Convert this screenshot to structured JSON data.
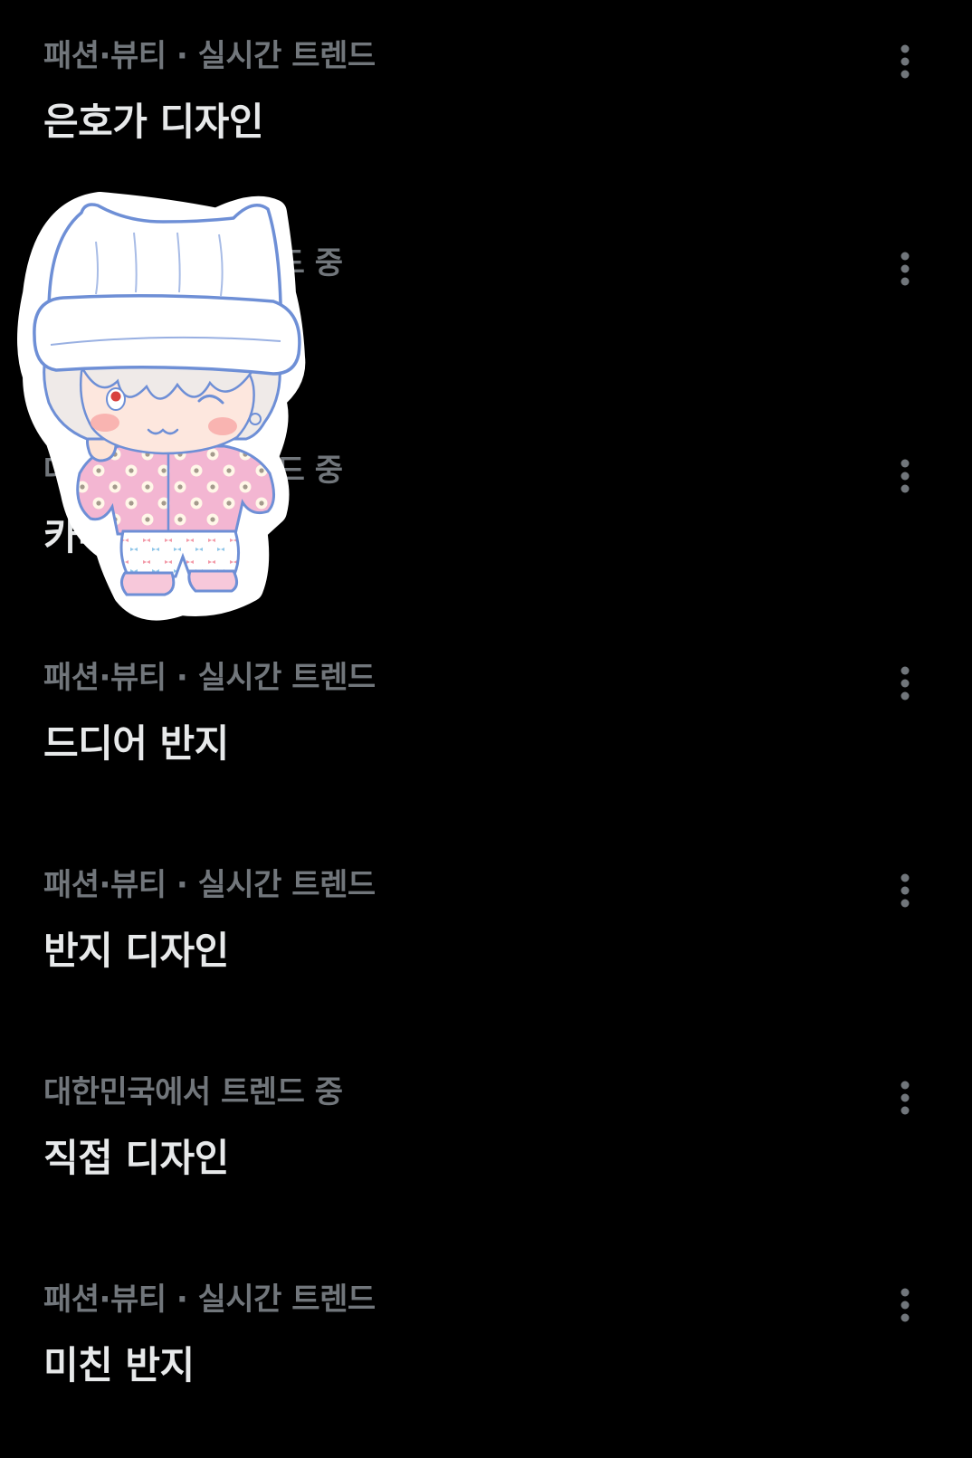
{
  "trends": [
    {
      "context": "패션·뷰티 · 실시간 트렌드",
      "title": "은호가 디자인"
    },
    {
      "context": "대한민국에서 트렌드 중",
      "title": ""
    },
    {
      "context": "대한민국에서 트렌드 중",
      "title": "카메"
    },
    {
      "context": "패션·뷰티 · 실시간 트렌드",
      "title": "드디어 반지"
    },
    {
      "context": "패션·뷰티 · 실시간 트렌드",
      "title": "반지 디자인"
    },
    {
      "context": "대한민국에서 트렌드 중",
      "title": "직접 디자인"
    },
    {
      "context": "패션·뷰티 · 실시간 트렌드",
      "title": "미친 반지"
    }
  ],
  "icons": {
    "more": "more-vertical-icon",
    "sticker": "chibi-character-sticker"
  },
  "colors": {
    "background": "#000000",
    "context_text": "#71767b",
    "title_text": "#e7e9ea",
    "icon": "#71767b"
  }
}
